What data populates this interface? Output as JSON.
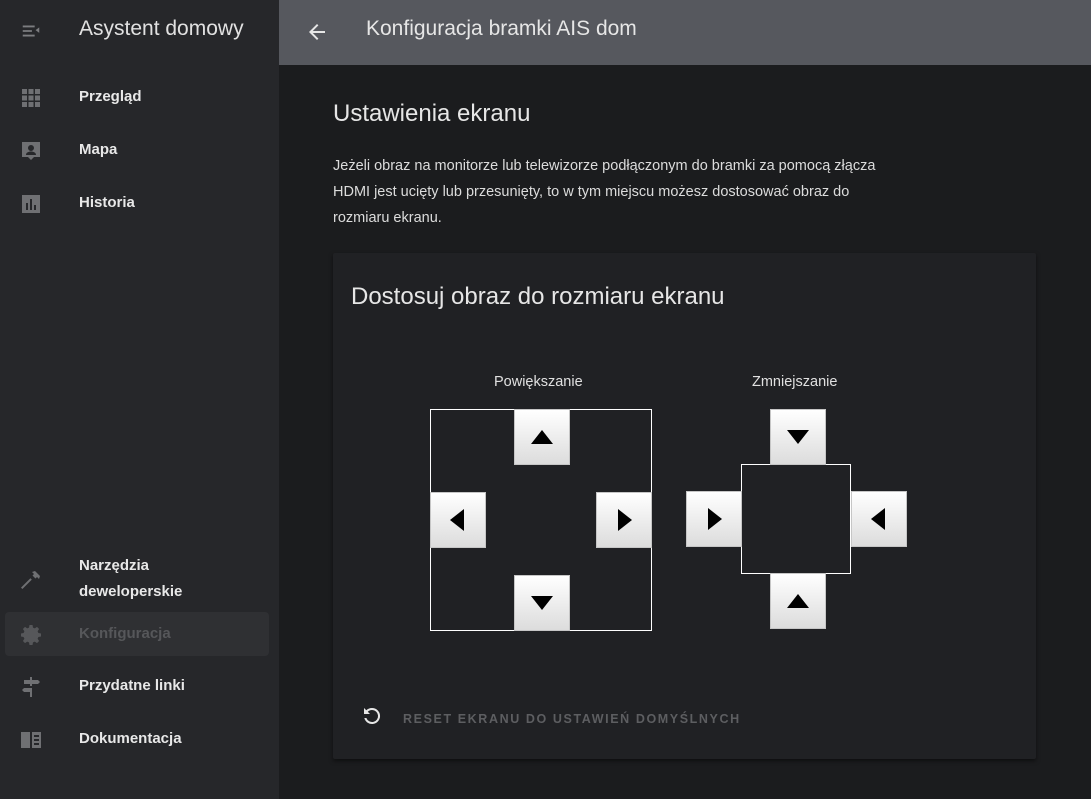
{
  "sidebar": {
    "title": "Asystent domowy",
    "items": [
      {
        "label": "Przegląd",
        "icon": "view-dashboard-icon"
      },
      {
        "label": "Mapa",
        "icon": "account-box-icon"
      },
      {
        "label": "Historia",
        "icon": "chart-box-icon"
      },
      {
        "label": "Narzędzia deweloperskie",
        "line1": "Narzędzia",
        "line2": "deweloperskie",
        "icon": "hammer-icon"
      },
      {
        "label": "Konfiguracja",
        "icon": "gear-icon",
        "active": true
      },
      {
        "label": "Przydatne linki",
        "icon": "signpost-icon"
      },
      {
        "label": "Dokumentacja",
        "icon": "book-open-icon"
      }
    ]
  },
  "topbar": {
    "title": "Konfiguracja bramki AIS dom"
  },
  "main": {
    "section_title": "Ustawienia ekranu",
    "section_desc": "Jeżeli obraz na monitorze lub telewizorze podłączonym do bramki za pomocą złącza HDMI jest ucięty lub przesunięty, to w tym miejscu możesz dostosować obraz do rozmiaru ekranu.",
    "card": {
      "title": "Dostosuj obraz do rozmiaru ekranu",
      "enlarge_label": "Powiększanie",
      "shrink_label": "Zmniejszanie",
      "reset_label": "RESET EKRANU DO USTAWIEŃ DOMYŚLNYCH"
    }
  },
  "colors": {
    "sidebar_bg": "#26272a",
    "topbar_bg": "#56585e",
    "page_bg": "#1b1c1e",
    "card_bg": "#202124",
    "active_item_bg": "#2f3033"
  }
}
